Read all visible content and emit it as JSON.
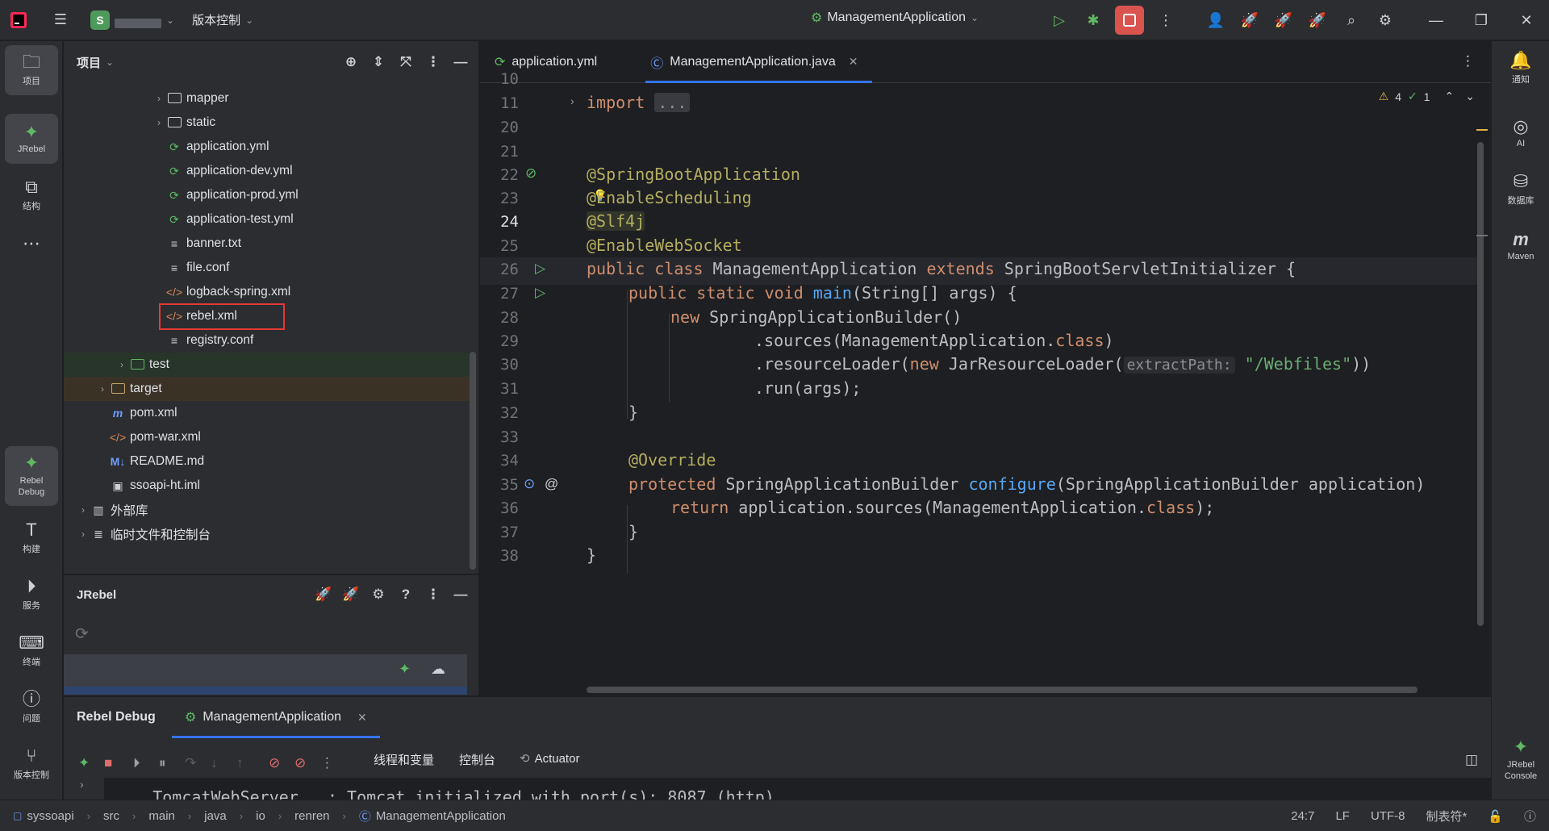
{
  "titlebar": {
    "project_letter": "S",
    "vcs_label": "版本控制",
    "run_config": "ManagementApplication"
  },
  "left_strip": {
    "items": [
      {
        "label": "项目",
        "icon": "folder-icon"
      },
      {
        "label": "JRebel",
        "icon": "jrebel-icon"
      },
      {
        "label": "结构",
        "icon": "structure-icon"
      },
      {
        "label": "Rebel Debug",
        "icon": "rebel-debug-icon"
      },
      {
        "label": "构建",
        "icon": "build-icon"
      },
      {
        "label": "服务",
        "icon": "services-icon"
      },
      {
        "label": "终端",
        "icon": "terminal-icon"
      },
      {
        "label": "问题",
        "icon": "problems-icon"
      },
      {
        "label": "版本控制",
        "icon": "vcs-icon"
      }
    ]
  },
  "right_strip": {
    "items": [
      {
        "label": "通知",
        "icon": "bell-icon"
      },
      {
        "label": "AI",
        "icon": "ai-icon"
      },
      {
        "label": "数据库",
        "icon": "database-icon"
      },
      {
        "label": "Maven",
        "icon": "maven-icon"
      },
      {
        "label": "JRebel Console",
        "icon": "jrebel-console-icon"
      }
    ]
  },
  "project_panel": {
    "title": "项目",
    "tree": [
      {
        "name": "mapper",
        "type": "folder",
        "expandable": true
      },
      {
        "name": "static",
        "type": "folder",
        "expandable": true
      },
      {
        "name": "application.yml",
        "type": "yml"
      },
      {
        "name": "application-dev.yml",
        "type": "yml"
      },
      {
        "name": "application-prod.yml",
        "type": "yml"
      },
      {
        "name": "application-test.yml",
        "type": "yml"
      },
      {
        "name": "banner.txt",
        "type": "txt"
      },
      {
        "name": "file.conf",
        "type": "txt"
      },
      {
        "name": "logback-spring.xml",
        "type": "xml"
      },
      {
        "name": "rebel.xml",
        "type": "xml"
      },
      {
        "name": "registry.conf",
        "type": "txt"
      },
      {
        "name": "test",
        "type": "folder",
        "expandable": true
      },
      {
        "name": "target",
        "type": "folder",
        "expandable": true
      },
      {
        "name": "pom.xml",
        "type": "maven"
      },
      {
        "name": "pom-war.xml",
        "type": "xml"
      },
      {
        "name": "README.md",
        "type": "md"
      },
      {
        "name": "ssoapi-ht.iml",
        "type": "iml"
      },
      {
        "name": "外部库",
        "type": "library",
        "expandable": true
      },
      {
        "name": "临时文件和控制台",
        "type": "scratch",
        "expandable": true
      }
    ]
  },
  "jrebel_panel": {
    "title": "JRebel"
  },
  "editor": {
    "tabs": [
      {
        "label": "application.yml",
        "active": false
      },
      {
        "label": "ManagementApplication.java",
        "active": true
      }
    ],
    "inspections": {
      "warnings": "4",
      "ok": "1"
    },
    "line_numbers": [
      "10",
      "11",
      "20",
      "21",
      "22",
      "23",
      "24",
      "25",
      "26",
      "27",
      "28",
      "29",
      "30",
      "31",
      "32",
      "33",
      "34",
      "35",
      "36",
      "37",
      "38"
    ],
    "current_line": "24",
    "code": {
      "l11_kw": "import",
      "l11_fold": "...",
      "l22": "@SpringBootApplication",
      "l23_a": "@",
      "l23_b": "EnableScheduling",
      "l24": "@Slf4j",
      "l25": "@EnableWebSocket",
      "l26_kw1": "public class",
      "l26_name": " ManagementApplication ",
      "l26_kw2": "extends",
      "l26_rest": " SpringBootServletInitializer {",
      "l27_kw": "public static void",
      "l27_fn": "main",
      "l27_rest": "(String[] args) {",
      "l28_kw": "new",
      "l28_rest": " SpringApplicationBuilder()",
      "l29_a": ".sources(ManagementApplication.",
      "l29_kw": "class",
      "l29_b": ")",
      "l30_a": ".resourceLoader(",
      "l30_kw": "new",
      "l30_b": " JarResourceLoader(",
      "l30_hint": "extractPath:",
      "l30_str": "\"/Webfiles\"",
      "l30_c": "))",
      "l31": ".run(args);",
      "l32": "}",
      "l34": "@Override",
      "l35_kw": "protected",
      "l35_a": " SpringApplicationBuilder ",
      "l35_fn": "configure",
      "l35_b": "(SpringApplicationBuilder application)",
      "l36_kw": "return",
      "l36_a": " application.sources(ManagementApplication.",
      "l36_kw2": "class",
      "l36_b": ");",
      "l37": "}",
      "l38": "}"
    }
  },
  "debug_panel": {
    "tabs": [
      {
        "label": "Rebel Debug",
        "active": true
      },
      {
        "label": "ManagementApplication",
        "active": false
      }
    ],
    "subtabs": [
      "线程和变量",
      "控制台",
      "Actuator"
    ],
    "console_line": ".TomcatWebServer   : Tomcat initialized with port(s): 8087 (http)"
  },
  "statusbar": {
    "breadcrumbs": [
      "syssoapi",
      "src",
      "main",
      "java",
      "io",
      "renren",
      "ManagementApplication"
    ],
    "position": "24:7",
    "line_sep": "LF",
    "encoding": "UTF-8",
    "indent": "制表符*"
  },
  "colors": {
    "accent": "#3574f0",
    "highlight_box": "#e53935",
    "stop_button": "#d9534f"
  }
}
